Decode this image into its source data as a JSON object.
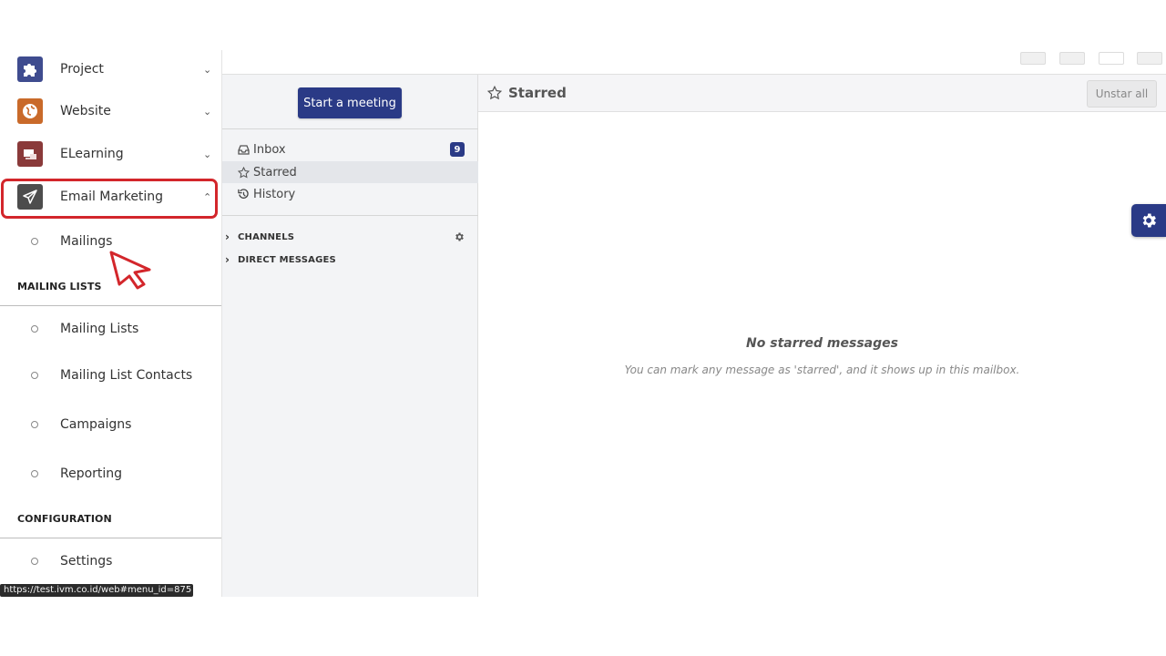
{
  "app_menu": {
    "apps": [
      {
        "label": "Project",
        "icon": "puzzle-icon",
        "chevron": "chevron-down-icon"
      },
      {
        "label": "Website",
        "icon": "globe-icon",
        "chevron": "chevron-down-icon"
      },
      {
        "label": "ELearning",
        "icon": "elearning-icon",
        "chevron": "chevron-down-icon"
      },
      {
        "label": "Email Marketing",
        "icon": "paper-plane-icon",
        "chevron": "chevron-up-icon"
      }
    ],
    "email_marketing_items": [
      "Mailings"
    ],
    "sections": [
      {
        "title": "MAILING LISTS",
        "items": [
          "Mailing Lists",
          "Mailing List Contacts",
          "Campaigns",
          "Reporting"
        ]
      },
      {
        "title": "CONFIGURATION",
        "items": [
          "Settings"
        ]
      }
    ],
    "status_url": "https://test.ivm.co.id/web#menu_id=875"
  },
  "discuss": {
    "start_meeting": "Start a meeting",
    "mailboxes": [
      {
        "label": "Inbox",
        "icon": "inbox-icon",
        "badge": "9"
      },
      {
        "label": "Starred",
        "icon": "star-icon"
      },
      {
        "label": "History",
        "icon": "history-icon"
      }
    ],
    "categories": [
      {
        "label": "CHANNELS",
        "icon": "chevron-right-icon"
      },
      {
        "label": "DIRECT MESSAGES",
        "icon": "chevron-right-icon"
      }
    ]
  },
  "main": {
    "title": "Starred",
    "unstar_all": "Unstar all",
    "empty_title": "No starred messages",
    "empty_text": "You can mark any message as 'starred', and it shows up in this mailbox."
  },
  "colors": {
    "accent": "#2a3a86",
    "highlight": "#d3262b"
  }
}
